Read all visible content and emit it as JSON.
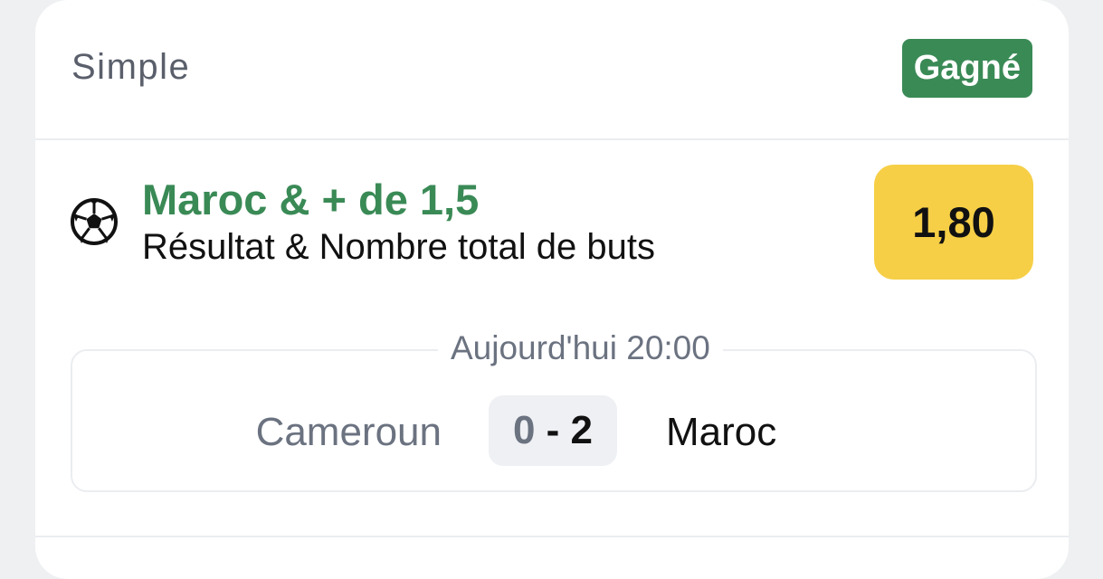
{
  "bet": {
    "type_label": "Simple",
    "status_label": "Gagné",
    "status_color": "#3a8a56"
  },
  "selection": {
    "sport_icon": "soccer-ball-icon",
    "pick": "Maroc & + de 1,5",
    "market": "Résultat & Nombre total de buts",
    "odds": "1,80",
    "odds_color": "#f6cf46"
  },
  "match": {
    "time": "Aujourd'hui 20:00",
    "home_team": "Cameroun",
    "away_team": "Maroc",
    "home_score": "0",
    "score_separator": " - ",
    "away_score": "2"
  }
}
